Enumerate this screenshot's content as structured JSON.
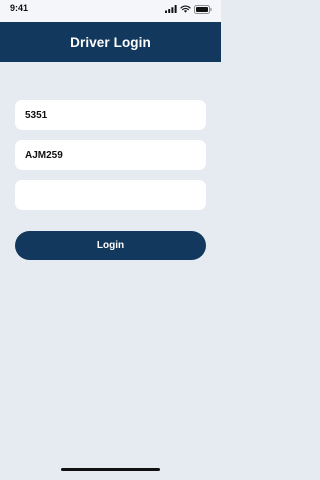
{
  "status_bar": {
    "time": "9:41",
    "icons": [
      "signal-icon",
      "wifi-icon",
      "battery-icon"
    ]
  },
  "header": {
    "title": "Driver Login"
  },
  "form": {
    "driver_id_value": "5351",
    "vehicle_value": "AJM259",
    "third_value": "",
    "login_label": "Login"
  },
  "colors": {
    "primary": "#12385e",
    "background": "#e5ebf1",
    "field": "#ffffff"
  }
}
